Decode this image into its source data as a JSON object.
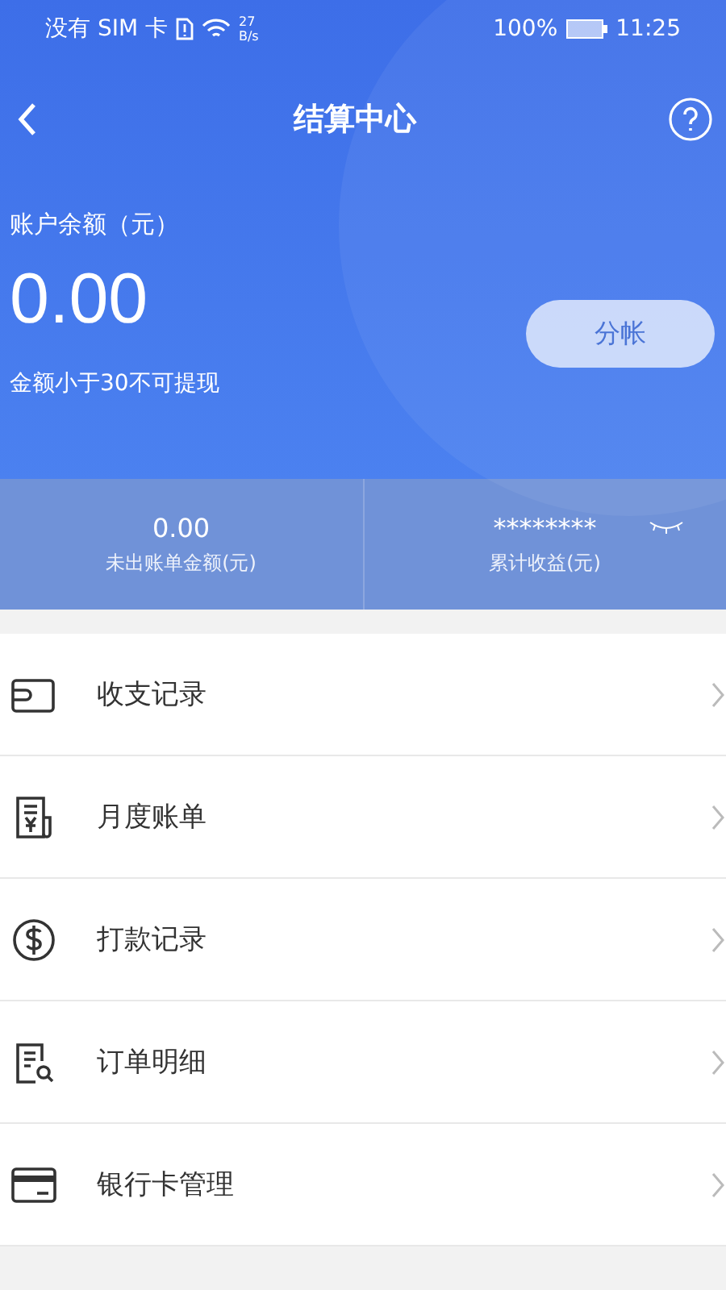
{
  "status_bar": {
    "carrier": "没有 SIM 卡",
    "speed_value": "27",
    "speed_unit": "B/s",
    "battery": "100%",
    "time": "11:25"
  },
  "nav": {
    "title": "结算中心"
  },
  "balance": {
    "label": "账户余额（元）",
    "amount": "0.00",
    "note": "金额小于30不可提现",
    "button": "分帐"
  },
  "stats": [
    {
      "value": "0.00",
      "label": "未出账单金额(元)",
      "hidden": false
    },
    {
      "value": "********",
      "label": "累计收益(元)",
      "hidden": true
    }
  ],
  "menu": [
    {
      "kind": "wallet",
      "label": "收支记录"
    },
    {
      "kind": "bill",
      "label": "月度账单"
    },
    {
      "kind": "dollar",
      "label": "打款记录"
    },
    {
      "kind": "order",
      "label": "订单明细"
    },
    {
      "kind": "card",
      "label": "银行卡管理"
    }
  ]
}
